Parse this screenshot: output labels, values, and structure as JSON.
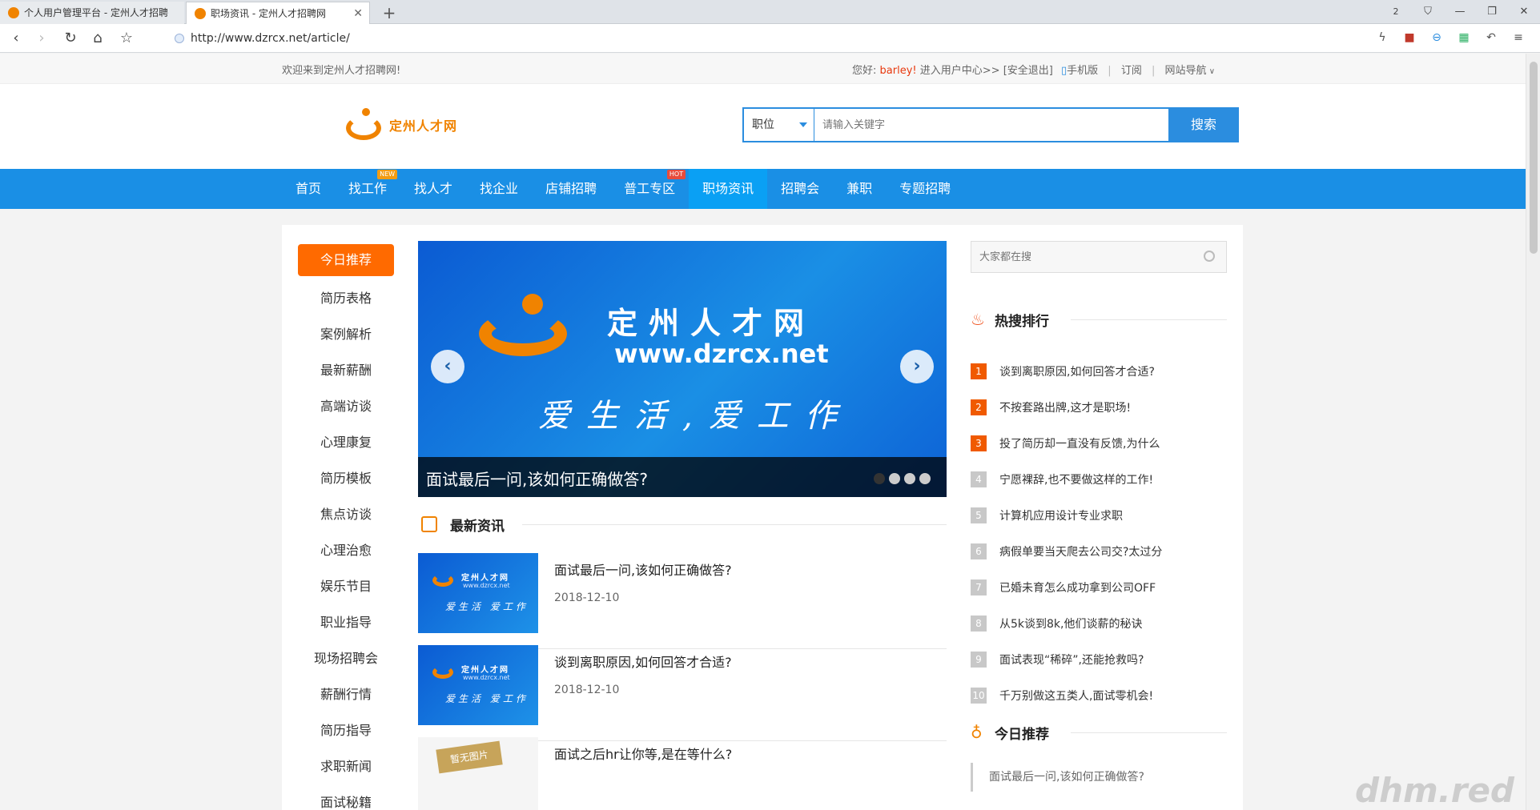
{
  "browser": {
    "tabs": [
      {
        "title": "个人用户管理平台 - 定州人才招聘",
        "active": false
      },
      {
        "title": "职场资讯 - 定州人才招聘网",
        "active": true
      }
    ],
    "tab_count": "2",
    "url": "http://www.dzrcx.net/article/"
  },
  "topbar": {
    "welcome": "欢迎来到定州人才招聘网!",
    "greeting": "您好:",
    "username": "barley!",
    "user_center": "进入用户中心>>",
    "logout": "[安全退出]",
    "mobile": "手机版",
    "subscribe": "订阅",
    "site_nav": "网站导航"
  },
  "header": {
    "logo_text": "定州人才网",
    "search_type": "职位",
    "search_placeholder": "请输入关键字",
    "search_button": "搜索"
  },
  "nav": {
    "items": [
      {
        "label": "首页",
        "badge": ""
      },
      {
        "label": "找工作",
        "badge": "NEW"
      },
      {
        "label": "找人才",
        "badge": ""
      },
      {
        "label": "找企业",
        "badge": ""
      },
      {
        "label": "店铺招聘",
        "badge": ""
      },
      {
        "label": "普工专区",
        "badge": "HOT"
      },
      {
        "label": "职场资讯",
        "badge": ""
      },
      {
        "label": "招聘会",
        "badge": ""
      },
      {
        "label": "兼职",
        "badge": ""
      },
      {
        "label": "专题招聘",
        "badge": ""
      }
    ],
    "active_index": 6
  },
  "sidebar": {
    "items": [
      "今日推荐",
      "简历表格",
      "案例解析",
      "最新薪酬",
      "高端访谈",
      "心理康复",
      "简历模板",
      "焦点访谈",
      "心理治愈",
      "娱乐节目",
      "职业指导",
      "现场招聘会",
      "薪酬行情",
      "简历指导",
      "求职新闻",
      "面试秘籍"
    ]
  },
  "carousel": {
    "cn_title": "定州人才网",
    "url_text": "www.dzrcx.net",
    "slogan": "爱生活,爱工作",
    "caption": "面试最后一问,该如何正确做答?",
    "slide_count": 4,
    "current": 0
  },
  "latest": {
    "title": "最新资讯",
    "thumb_title": "定州人才网",
    "thumb_url": "www.dzrcx.net",
    "thumb_slogan": "爱生活 爱工作",
    "placeholder_text": "暂无图片",
    "items": [
      {
        "title": "面试最后一问,该如何正确做答?",
        "date": "2018-12-10",
        "has_image": true
      },
      {
        "title": "谈到离职原因,如何回答才合适?",
        "date": "2018-12-10",
        "has_image": true
      },
      {
        "title": "面试之后hr让你等,是在等什么?",
        "date": "",
        "has_image": false
      }
    ]
  },
  "right": {
    "search_placeholder": "大家都在搜",
    "hot_title": "热搜排行",
    "hot": [
      {
        "rank": "1",
        "text": "谈到离职原因,如何回答才合适?"
      },
      {
        "rank": "2",
        "text": "不按套路出牌,这才是职场!"
      },
      {
        "rank": "3",
        "text": "投了简历却一直没有反馈,为什么"
      },
      {
        "rank": "4",
        "text": "宁愿裸辞,也不要做这样的工作!"
      },
      {
        "rank": "5",
        "text": "计算机应用设计专业求职"
      },
      {
        "rank": "6",
        "text": "病假单要当天爬去公司交?太过分"
      },
      {
        "rank": "7",
        "text": "已婚未育怎么成功拿到公司OFF"
      },
      {
        "rank": "8",
        "text": "从5k谈到8k,他们谈薪的秘诀"
      },
      {
        "rank": "9",
        "text": "面试表现“稀碎”,还能抢救吗?"
      },
      {
        "rank": "10",
        "text": "千万别做这五类人,面试零机会!"
      }
    ],
    "rec_title": "今日推荐",
    "rec_first": "面试最后一问,该如何正确做答?"
  },
  "watermark": "dhm.red"
}
